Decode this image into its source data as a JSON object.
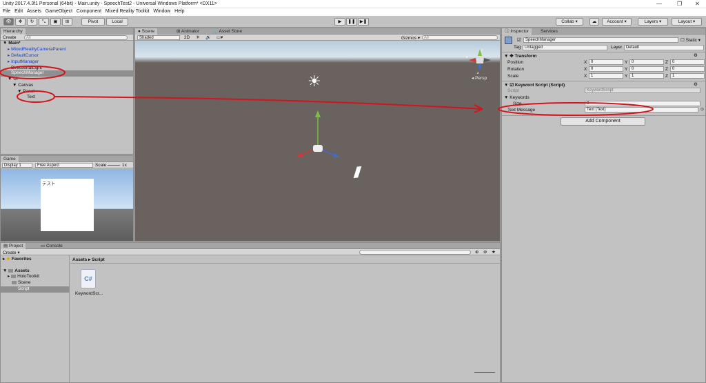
{
  "window_title": "Unity 2017.4.3f1 Personal (64bit) - Main.unity - SpeechTest2 - Universal Windows Platform* <DX11>",
  "window_controls": {
    "minimize": "—",
    "maximize": "❐",
    "close": "✕"
  },
  "menu": [
    "File",
    "Edit",
    "Assets",
    "GameObject",
    "Component",
    "Mixed Reality Toolkit",
    "Window",
    "Help"
  ],
  "toolbar": {
    "pivot": "Pivot",
    "local": "Local",
    "collab": "Collab",
    "account": "Account",
    "layers": "Layers",
    "layout": "Layout"
  },
  "hierarchy": {
    "tab": "Hierarchy",
    "create": "Create",
    "search": "All",
    "scene": "Main*",
    "items": [
      "MixedRealityCameraParent",
      "DefaultCursor",
      "InputManager",
      "DirectionalLight",
      "SpeechManager",
      "UI",
      "Canvas",
      "Panel",
      "Text"
    ]
  },
  "game": {
    "tab": "Game",
    "display": "Display 1",
    "aspect": "Free Aspect",
    "scale_label": "Scale",
    "scale_value": "1x",
    "canvas_text": "テスト"
  },
  "scene": {
    "tabs": [
      "Scene",
      "Animator",
      "Asset Store"
    ],
    "shaded": "Shaded",
    "mode2d": "2D",
    "gizmos": "Gizmos",
    "search": "All",
    "persp": "Persp",
    "axes": [
      "y",
      "x",
      "z"
    ]
  },
  "project": {
    "tabs": [
      "Project",
      "Console"
    ],
    "create": "Create",
    "favorites": "Favorites",
    "assets": "Assets",
    "folders": [
      "HoloToolkit",
      "Scene",
      "Script"
    ],
    "breadcrumb": [
      "Assets",
      "Script"
    ],
    "file_name": "KeywordScr...",
    "file_icon": "C#"
  },
  "inspector": {
    "tabs": [
      "Inspector",
      "Services"
    ],
    "object_name": "SpeechManager",
    "static_label": "Static",
    "tag_label": "Tag",
    "tag_value": "Untagged",
    "layer_label": "Layer",
    "layer_value": "Default",
    "transform": {
      "title": "Transform",
      "rows": [
        {
          "label": "Position",
          "x": "0",
          "y": "0",
          "z": "0"
        },
        {
          "label": "Rotation",
          "x": "0",
          "y": "0",
          "z": "0"
        },
        {
          "label": "Scale",
          "x": "1",
          "y": "1",
          "z": "1"
        }
      ]
    },
    "axis_labels": [
      "X",
      "Y",
      "Z"
    ],
    "component": {
      "title": "Keyword Script (Script)",
      "script_label": "Script",
      "script_value": "KeywordScript",
      "keywords_label": "Keywords",
      "size_label": "Size",
      "size_value": "0",
      "text_message_label": "Text Message",
      "text_message_value": "Text (Text)"
    },
    "add_component": "Add Component"
  }
}
